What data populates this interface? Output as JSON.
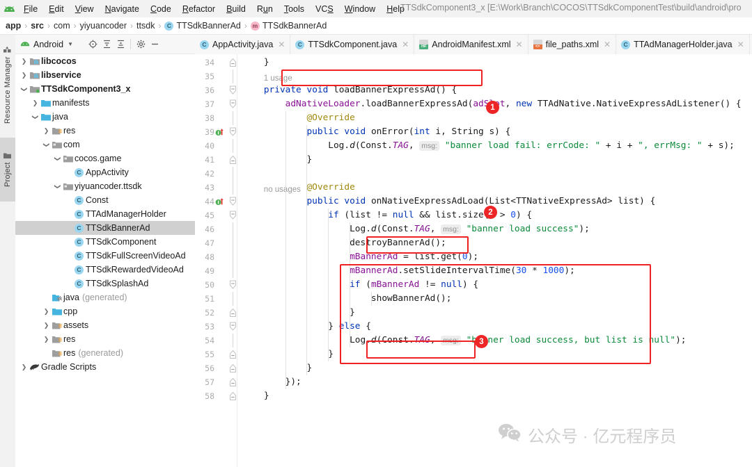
{
  "window": {
    "title": "TTSdkComponent3_x [E:\\Work\\Branch\\COCOS\\TTSdkComponentTest\\build\\android\\pro"
  },
  "menubar": {
    "logo": "android-logo-icon",
    "items": [
      {
        "label": "File",
        "mnemonic": "F"
      },
      {
        "label": "Edit",
        "mnemonic": "E"
      },
      {
        "label": "View",
        "mnemonic": "V"
      },
      {
        "label": "Navigate",
        "mnemonic": "N"
      },
      {
        "label": "Code",
        "mnemonic": "C"
      },
      {
        "label": "Refactor",
        "mnemonic": "R"
      },
      {
        "label": "Build",
        "mnemonic": "B"
      },
      {
        "label": "Run",
        "mnemonic": "u"
      },
      {
        "label": "Tools",
        "mnemonic": "T"
      },
      {
        "label": "VCS",
        "mnemonic": "S"
      },
      {
        "label": "Window",
        "mnemonic": "W"
      },
      {
        "label": "Help",
        "mnemonic": "H"
      }
    ]
  },
  "breadcrumb": {
    "items": [
      {
        "label": "app",
        "bold": true,
        "icon": ""
      },
      {
        "label": "src",
        "bold": true,
        "icon": ""
      },
      {
        "label": "com",
        "bold": false,
        "icon": ""
      },
      {
        "label": "yiyuancoder",
        "bold": false,
        "icon": ""
      },
      {
        "label": "ttsdk",
        "bold": false,
        "icon": ""
      },
      {
        "label": "TTSdkBannerAd",
        "bold": false,
        "icon": "class-icon",
        "glyph": "C"
      },
      {
        "label": "TTSdkBannerAd",
        "bold": false,
        "icon": "method-icon",
        "glyph": "m"
      }
    ],
    "separator": "›"
  },
  "tool_strip": {
    "buttons": [
      {
        "label": "Resource Manager",
        "icon": "resource-manager-icon"
      },
      {
        "label": "Project",
        "icon": "folder-icon",
        "active": true
      }
    ]
  },
  "project_panel": {
    "title": "Android",
    "dropdown_glyph": "▾",
    "toolbar_icons": [
      "locate-icon",
      "expand-all-icon",
      "collapse-all-icon",
      "settings-icon",
      "hide-icon"
    ],
    "tree": [
      {
        "depth": 0,
        "arrow": "collapsed",
        "icon": "module-icon",
        "label": "libcocos",
        "bold": true,
        "suffix": ""
      },
      {
        "depth": 0,
        "arrow": "collapsed",
        "icon": "module-icon",
        "label": "libservice",
        "bold": true,
        "suffix": ""
      },
      {
        "depth": 0,
        "arrow": "expanded",
        "icon": "module-green-icon",
        "label": "TTSdkComponent3_x",
        "bold": true,
        "suffix": ""
      },
      {
        "depth": 1,
        "arrow": "collapsed",
        "icon": "folder-blue-icon",
        "label": "manifests",
        "bold": false,
        "suffix": ""
      },
      {
        "depth": 1,
        "arrow": "expanded",
        "icon": "folder-blue-icon",
        "label": "java",
        "bold": false,
        "suffix": ""
      },
      {
        "depth": 2,
        "arrow": "collapsed",
        "icon": "res-folder-icon",
        "label": "res",
        "bold": false,
        "suffix": ""
      },
      {
        "depth": 2,
        "arrow": "expanded",
        "icon": "package-icon",
        "label": "com",
        "bold": false,
        "suffix": ""
      },
      {
        "depth": 3,
        "arrow": "expanded",
        "icon": "package-icon",
        "label": "cocos.game",
        "bold": false,
        "suffix": ""
      },
      {
        "depth": 4,
        "arrow": "none",
        "icon": "java-class-icon",
        "label": "AppActivity",
        "bold": false,
        "suffix": ""
      },
      {
        "depth": 3,
        "arrow": "expanded",
        "icon": "package-icon",
        "label": "yiyuancoder.ttsdk",
        "bold": false,
        "suffix": ""
      },
      {
        "depth": 4,
        "arrow": "none",
        "icon": "java-class-icon",
        "label": "Const",
        "bold": false,
        "suffix": ""
      },
      {
        "depth": 4,
        "arrow": "none",
        "icon": "java-class-icon",
        "label": "TTAdManagerHolder",
        "bold": false,
        "suffix": ""
      },
      {
        "depth": 4,
        "arrow": "none",
        "icon": "java-class-icon",
        "label": "TTSdkBannerAd",
        "bold": false,
        "suffix": "",
        "selected": true
      },
      {
        "depth": 4,
        "arrow": "none",
        "icon": "java-class-icon",
        "label": "TTSdkComponent",
        "bold": false,
        "suffix": ""
      },
      {
        "depth": 4,
        "arrow": "none",
        "icon": "java-class-icon",
        "label": "TTSdkFullScreenVideoAd",
        "bold": false,
        "suffix": ""
      },
      {
        "depth": 4,
        "arrow": "none",
        "icon": "java-class-icon",
        "label": "TTSdkRewardedVideoAd",
        "bold": false,
        "suffix": ""
      },
      {
        "depth": 4,
        "arrow": "none",
        "icon": "java-class-icon",
        "label": "TTSdkSplashAd",
        "bold": false,
        "suffix": ""
      },
      {
        "depth": 2,
        "arrow": "none",
        "icon": "generated-folder-icon",
        "label": "java",
        "bold": false,
        "suffix": "(generated)"
      },
      {
        "depth": 2,
        "arrow": "collapsed",
        "icon": "folder-blue-icon",
        "label": "cpp",
        "bold": false,
        "suffix": ""
      },
      {
        "depth": 2,
        "arrow": "collapsed",
        "icon": "res-folder-icon",
        "label": "assets",
        "bold": false,
        "suffix": ""
      },
      {
        "depth": 2,
        "arrow": "collapsed",
        "icon": "res-folder-icon",
        "label": "res",
        "bold": false,
        "suffix": ""
      },
      {
        "depth": 2,
        "arrow": "none",
        "icon": "res-folder-icon",
        "label": "res",
        "bold": false,
        "suffix": "(generated)"
      },
      {
        "depth": 0,
        "arrow": "collapsed",
        "icon": "gradle-icon",
        "label": "Gradle Scripts",
        "bold": false,
        "suffix": ""
      }
    ]
  },
  "editor_tabs": [
    {
      "label": "AppActivity.java",
      "icon": "java-class-icon",
      "glyph": "C",
      "active": false
    },
    {
      "label": "TTSdkComponent.java",
      "icon": "java-class-icon",
      "glyph": "C",
      "active": false
    },
    {
      "label": "AndroidManifest.xml",
      "icon": "manifest-xml-icon",
      "glyph": "HF",
      "active": false
    },
    {
      "label": "file_paths.xml",
      "icon": "xml-icon",
      "glyph": "<>",
      "active": false
    },
    {
      "label": "TTAdManagerHolder.java",
      "icon": "java-class-icon",
      "glyph": "C",
      "active": false
    }
  ],
  "editor": {
    "first_line": 34,
    "last_line": 58,
    "line_numbers": [
      34,
      35,
      36,
      37,
      38,
      39,
      40,
      41,
      42,
      43,
      44,
      45,
      46,
      47,
      48,
      49,
      50,
      51,
      52,
      53,
      54,
      55,
      56,
      57,
      58
    ],
    "gutter_markers": [
      {
        "line": 39,
        "icon": "overriding-method-icon"
      },
      {
        "line": 44,
        "icon": "overriding-method-icon"
      }
    ],
    "inlay_hints": {
      "msg": "msg:"
    },
    "gutter_usages": [
      {
        "line": 36,
        "text": "1 usage"
      },
      {
        "line": 44,
        "text": "no usages"
      }
    ],
    "code_lines": [
      {
        "line": 34,
        "text": "    }"
      },
      {
        "line": 35,
        "text": ""
      },
      {
        "line": 36,
        "text": "    private void loadBannerExpressAd() {"
      },
      {
        "line": 37,
        "text": "        adNativeLoader.loadBannerExpressAd(adSlot, new TTAdNative.NativeExpressAdListener() {"
      },
      {
        "line": 38,
        "text": "            @Override"
      },
      {
        "line": 39,
        "text": "            public void onError(int i, String s) {"
      },
      {
        "line": 40,
        "text": "                Log.d(Const.TAG, msg: \"banner load fail: errCode: \" + i + \", errMsg: \" + s);"
      },
      {
        "line": 41,
        "text": "            }"
      },
      {
        "line": 42,
        "text": ""
      },
      {
        "line": 43,
        "text": "            @Override"
      },
      {
        "line": 44,
        "text": "            public void onNativeExpressAdLoad(List<TTNativeExpressAd> list) {"
      },
      {
        "line": 45,
        "text": "                if (list != null && list.size() > 0) {"
      },
      {
        "line": 46,
        "text": "                    Log.d(Const.TAG, msg: \"banner load success\");"
      },
      {
        "line": 47,
        "text": "                    destroyBannerAd();"
      },
      {
        "line": 48,
        "text": "                    mBannerAd = list.get(0);"
      },
      {
        "line": 49,
        "text": "                    mBannerAd.setSlideIntervalTime(30 * 1000);"
      },
      {
        "line": 50,
        "text": "                    if (mBannerAd != null) {"
      },
      {
        "line": 51,
        "text": "                        showBannerAd();"
      },
      {
        "line": 52,
        "text": "                    }"
      },
      {
        "line": 53,
        "text": "                } else {"
      },
      {
        "line": 54,
        "text": "                    Log.d(Const.TAG, msg: \"banner load success, but list is null\");"
      },
      {
        "line": 55,
        "text": "                }"
      },
      {
        "line": 56,
        "text": "            }"
      },
      {
        "line": 57,
        "text": "        });"
      },
      {
        "line": 58,
        "text": "    }"
      }
    ]
  },
  "annotations": {
    "color": "#ee2222",
    "badges": [
      {
        "number": "1",
        "target": "adNativeLoader.loadBannerExpressAd"
      },
      {
        "number": "2",
        "target": "onNativeExpressAdLoad"
      },
      {
        "number": "3",
        "target": "showBannerAd();"
      }
    ]
  },
  "watermark": {
    "icon": "wechat-icon",
    "text": "公众号 · 亿元程序员"
  }
}
